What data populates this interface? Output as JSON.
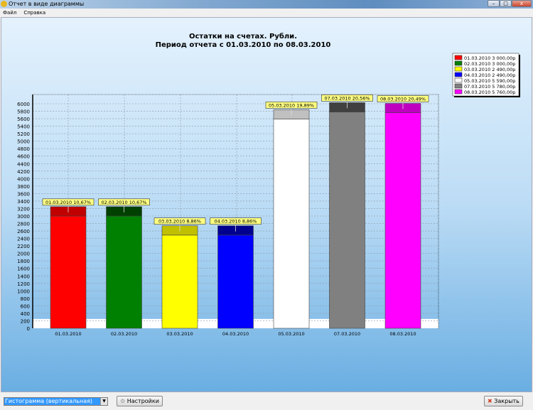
{
  "window": {
    "title": "Отчет в виде диаграммы",
    "minimize": "–",
    "maximize": "□",
    "close": "x"
  },
  "menu": [
    "Файл",
    "Справка"
  ],
  "bottom": {
    "chart_type": "Гистограмма (вертикальная)",
    "settings": "Настройки",
    "close": "Закрыть"
  },
  "chart_data": {
    "type": "bar",
    "title": "Остатки на счетах. Рубли.",
    "subtitle": "Период отчета с 01.03.2010 по 08.03.2010",
    "categories": [
      "01.03.2010",
      "02.03.2010",
      "03.03.2010",
      "04.03.2010",
      "05.03.2010",
      "07.03.2010",
      "08.03.2010"
    ],
    "values": [
      3000,
      3000,
      2490,
      2490,
      5590,
      5780,
      5760
    ],
    "data_labels": [
      "01.03.2010 10,67%",
      "02.03.2010 10,67%",
      "03.03.2010 8,86%",
      "04.03.2010 8,86%",
      "05.03.2010 19,89%",
      "07.03.2010 20,56%",
      "08.03.2010 20,49%"
    ],
    "legend": [
      "01.03.2010 3 000,00р",
      "02.03.2010 3 000,00р",
      "03.03.2010 2 490,00р",
      "04.03.2010 2 490,00р",
      "05.03.2010 5 590,00р",
      "07.03.2010 5 780,00р",
      "08.03.2010 5 760,00р"
    ],
    "legend_position": "top-right",
    "colors": [
      "#ff0000",
      "#008000",
      "#ffff00",
      "#0000ff",
      "#ffffff",
      "#808080",
      "#ff00ff"
    ],
    "cap_colors": [
      "#c00000",
      "#004000",
      "#c0c000",
      "#000090",
      "#c0c0c0",
      "#404040",
      "#c000c0"
    ],
    "yticks": [
      0,
      200,
      400,
      600,
      800,
      1000,
      1200,
      1400,
      1600,
      1800,
      2000,
      2200,
      2400,
      2600,
      2800,
      3000,
      3200,
      3400,
      3600,
      3800,
      4000,
      4200,
      4400,
      4600,
      4800,
      5000,
      5200,
      5400,
      5600,
      5800,
      6000
    ],
    "ylim": [
      0,
      6300
    ],
    "grid": true
  }
}
